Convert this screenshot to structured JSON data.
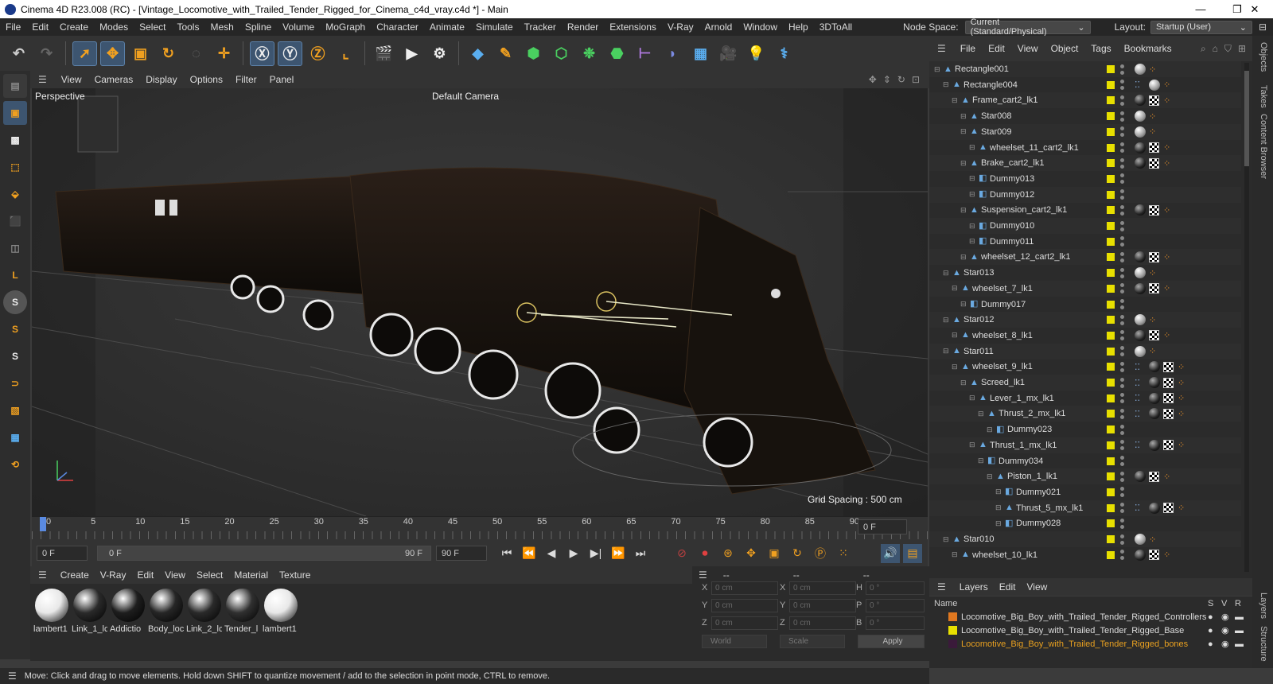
{
  "window": {
    "title": "Cinema 4D R23.008 (RC) - [Vintage_Locomotive_with_Trailed_Tender_Rigged_for_Cinema_c4d_vray.c4d *] - Main",
    "minimize": "—",
    "maximize": "❐",
    "close": "✕"
  },
  "menu": {
    "items": [
      "File",
      "Edit",
      "Create",
      "Modes",
      "Select",
      "Tools",
      "Mesh",
      "Spline",
      "Volume",
      "MoGraph",
      "Character",
      "Animate",
      "Simulate",
      "Tracker",
      "Render",
      "Extensions",
      "V-Ray",
      "Arnold",
      "Window",
      "Help",
      "3DToAll"
    ],
    "node_space_label": "Node Space:",
    "node_space_value": "Current (Standard/Physical)",
    "layout_label": "Layout:",
    "layout_value": "Startup (User)"
  },
  "viewport": {
    "menu": [
      "View",
      "Cameras",
      "Display",
      "Options",
      "Filter",
      "Panel"
    ],
    "perspective": "Perspective",
    "camera": "Default Camera",
    "grid_spacing": "Grid Spacing : 500 cm"
  },
  "timeline": {
    "ticks": [
      "0",
      "5",
      "10",
      "15",
      "20",
      "25",
      "30",
      "35",
      "40",
      "45",
      "50",
      "55",
      "60",
      "65",
      "70",
      "75",
      "80",
      "85",
      "90"
    ],
    "current_frame": "0 F",
    "start": "0 F",
    "range_start": "0 F",
    "range_end": "90 F",
    "end": "90 F"
  },
  "materials": {
    "menu": [
      "Create",
      "V-Ray",
      "Edit",
      "View",
      "Select",
      "Material",
      "Texture"
    ],
    "items": [
      {
        "name": "lambert1",
        "color": "#e8e8e8"
      },
      {
        "name": "Link_1_lc",
        "color": "#2a2a2a"
      },
      {
        "name": "Addictio",
        "color": "#1e1e1e"
      },
      {
        "name": "Body_loc",
        "color": "#262626"
      },
      {
        "name": "Link_2_lc",
        "color": "#2a2a2a"
      },
      {
        "name": "Tender_l",
        "color": "#303030"
      },
      {
        "name": "lambert1",
        "color": "#e8e8e8"
      }
    ]
  },
  "coords": {
    "headers": [
      "--",
      "--",
      "--"
    ],
    "x_pos": "0 cm",
    "y_pos": "0 cm",
    "z_pos": "0 cm",
    "x_size": "0 cm",
    "y_size": "0 cm",
    "z_size": "0 cm",
    "h": "0 °",
    "p": "0 °",
    "b": "0 °",
    "labels": {
      "x": "X",
      "y": "Y",
      "z": "Z",
      "h": "H",
      "p": "P",
      "b": "B"
    },
    "mode": "World",
    "scale": "Scale",
    "apply": "Apply"
  },
  "status": "Move: Click and drag to move elements. Hold down SHIFT to quantize movement / add to the selection in point mode, CTRL to remove.",
  "objects": {
    "menu": [
      "File",
      "Edit",
      "View",
      "Object",
      "Tags",
      "Bookmarks"
    ],
    "rows": [
      {
        "name": "Rectangle001",
        "indent": 0
      },
      {
        "name": "Rectangle004",
        "indent": 1
      },
      {
        "name": "Frame_cart2_lk1",
        "indent": 2
      },
      {
        "name": "Star008",
        "indent": 3
      },
      {
        "name": "Star009",
        "indent": 3
      },
      {
        "name": "wheelset_11_cart2_lk1",
        "indent": 4
      },
      {
        "name": "Brake_cart2_lk1",
        "indent": 3
      },
      {
        "name": "Dummy013",
        "indent": 4
      },
      {
        "name": "Dummy012",
        "indent": 4
      },
      {
        "name": "Suspension_cart2_lk1",
        "indent": 3
      },
      {
        "name": "Dummy010",
        "indent": 4
      },
      {
        "name": "Dummy011",
        "indent": 4
      },
      {
        "name": "wheelset_12_cart2_lk1",
        "indent": 3
      },
      {
        "name": "Star013",
        "indent": 1
      },
      {
        "name": "wheelset_7_lk1",
        "indent": 2
      },
      {
        "name": "Dummy017",
        "indent": 3
      },
      {
        "name": "Star012",
        "indent": 1
      },
      {
        "name": "wheelset_8_lk1",
        "indent": 2
      },
      {
        "name": "Star011",
        "indent": 1
      },
      {
        "name": "wheelset_9_lk1",
        "indent": 2
      },
      {
        "name": "Screed_lk1",
        "indent": 3
      },
      {
        "name": "Lever_1_mx_lk1",
        "indent": 4
      },
      {
        "name": "Thrust_2_mx_lk1",
        "indent": 5
      },
      {
        "name": "Dummy023",
        "indent": 6
      },
      {
        "name": "Thrust_1_mx_lk1",
        "indent": 4
      },
      {
        "name": "Dummy034",
        "indent": 5
      },
      {
        "name": "Piston_1_lk1",
        "indent": 6
      },
      {
        "name": "Dummy021",
        "indent": 7
      },
      {
        "name": "Thrust_5_mx_lk1",
        "indent": 7
      },
      {
        "name": "Dummy028",
        "indent": 7
      },
      {
        "name": "Star010",
        "indent": 1
      },
      {
        "name": "wheelset_10_lk1",
        "indent": 2
      }
    ]
  },
  "layers": {
    "menu": [
      "Layers",
      "Edit",
      "View"
    ],
    "name_header": "Name",
    "cols": [
      "S",
      "V",
      "R"
    ],
    "rows": [
      {
        "name": "Locomotive_Big_Boy_with_Trailed_Tender_Rigged_Controllers",
        "color": "#e07820",
        "text_color": "#dddddd"
      },
      {
        "name": "Locomotive_Big_Boy_with_Trailed_Tender_Rigged_Base",
        "color": "#e8e000",
        "text_color": "#dddddd"
      },
      {
        "name": "Locomotive_Big_Boy_with_Trailed_Tender_Rigged_bones",
        "color": "#3a1a3a",
        "text_color": "#e8a020"
      }
    ]
  },
  "side_tabs": [
    "Objects",
    "Takes",
    "Content Browser",
    "Layers",
    "Structure"
  ]
}
